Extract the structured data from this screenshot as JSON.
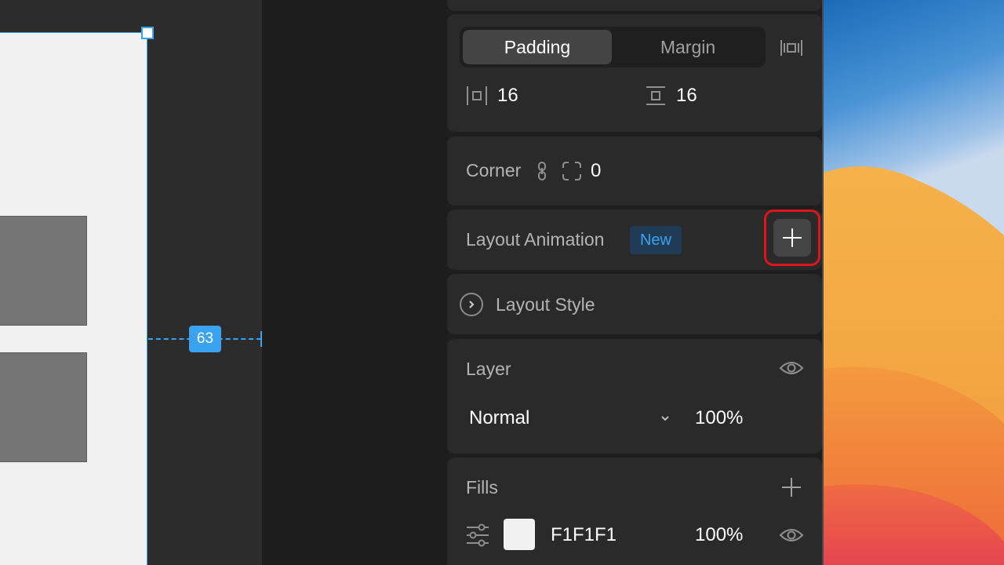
{
  "canvas": {
    "measure_value": "63"
  },
  "spacing": {
    "tabs": [
      {
        "label": "Padding",
        "active": true
      },
      {
        "label": "Margin",
        "active": false
      }
    ],
    "horizontal_padding": "16",
    "vertical_padding": "16"
  },
  "corner": {
    "label": "Corner",
    "value": "0"
  },
  "layout_animation": {
    "label": "Layout Animation",
    "badge": "New"
  },
  "layout_style": {
    "label": "Layout Style"
  },
  "layer": {
    "label": "Layer",
    "blend_mode": "Normal",
    "opacity": "100%"
  },
  "fills": {
    "label": "Fills",
    "color_hex": "F1F1F1",
    "opacity": "100%"
  },
  "colors": {
    "accent": "#3AA3F0",
    "highlight": "#E0141B",
    "panel": "#2A2A2A",
    "fill_swatch": "#F1F1F1"
  }
}
